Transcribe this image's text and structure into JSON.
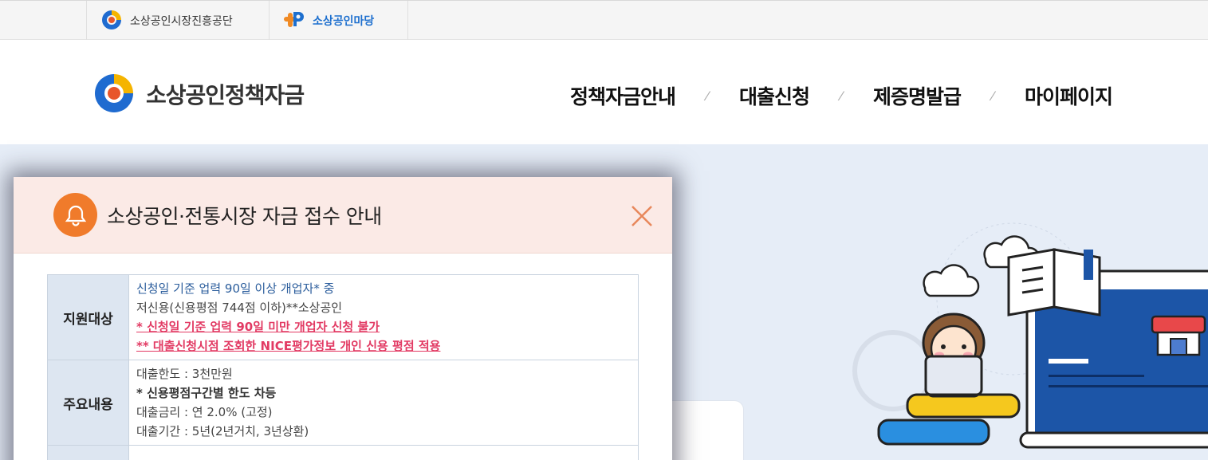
{
  "util": {
    "link1": "소상공인시장진흥공단",
    "link2": "소상공인마당"
  },
  "header": {
    "brand": "소상공인정책자금",
    "nav": [
      "정책자금안내",
      "대출신청",
      "제증명발급",
      "마이페이지"
    ]
  },
  "popup": {
    "title": "소상공인·전통시장 자금 접수 안내",
    "rows": [
      {
        "label": "지원대상",
        "lines": [
          "신청일 기준 업력 90일 이상 개업자* 중",
          "저신용(신용평점 744점 이하)**소상공인",
          "* 신청일 기준 업력 90일 미만 개업자 신청 불가",
          "** 대출신청시점 조회한 NICE평가정보 개인 신용 평점 적용"
        ]
      },
      {
        "label": "주요내용",
        "lines": [
          "대출한도 : 3천만원",
          "* 신용평점구간별 한도 차등",
          "대출금리 : 연 2.0% (고정)",
          "대출기간 : 5년(2년거치, 3년상환)"
        ]
      }
    ]
  },
  "colors": {
    "accent_orange": "#f07b2b",
    "popup_header_bg": "#fbeae6",
    "table_header_bg": "#dde6f1",
    "warning_red": "#e23a63",
    "link_blue": "#1d6fce"
  },
  "icons": {
    "brand_logo": "semas-logo-icon",
    "madang_logo": "madang-p-logo-icon",
    "bell": "bell-icon",
    "close": "close-icon"
  }
}
